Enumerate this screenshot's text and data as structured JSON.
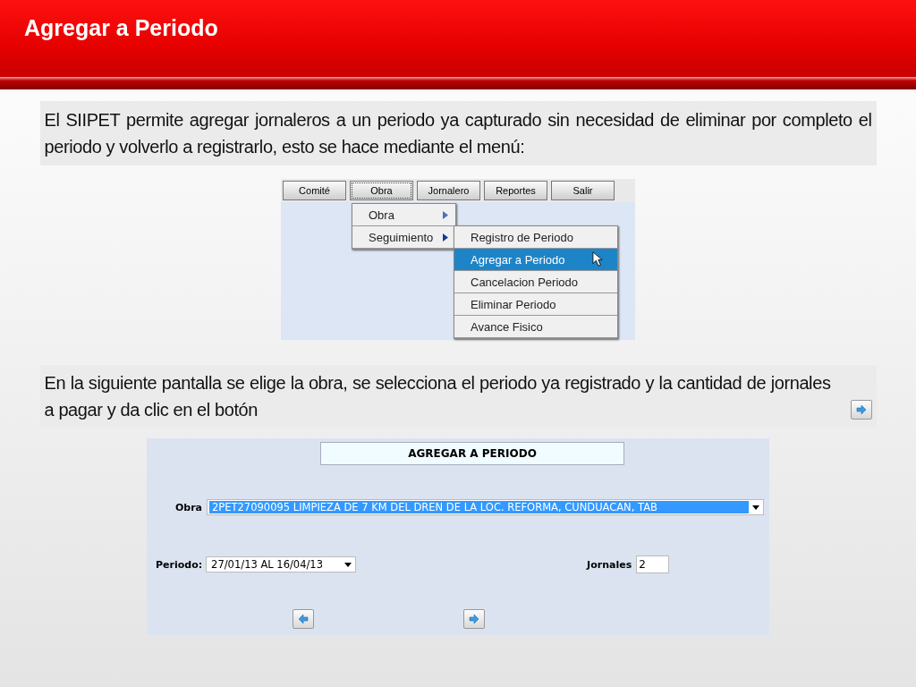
{
  "title": "Agregar a Periodo",
  "intro": "El SIIPET permite agregar jornaleros a un periodo ya capturado sin necesidad de eliminar por completo el periodo y volverlo a registrarlo, esto se hace mediante el menú:",
  "menu_screenshot": {
    "menu_bar": [
      {
        "label": "Comité",
        "selected": false
      },
      {
        "label": "Obra",
        "selected": true
      },
      {
        "label": "Jornalero",
        "selected": false
      },
      {
        "label": "Reportes",
        "selected": false
      },
      {
        "label": "Salir",
        "selected": false
      }
    ],
    "submenu": [
      {
        "label": "Obra",
        "expanded": false
      },
      {
        "label": "Seguimiento",
        "expanded": true
      }
    ],
    "submenu_items": [
      {
        "label": "Registro de Periodo",
        "selected": false
      },
      {
        "label": "Agregar a Periodo",
        "selected": true
      },
      {
        "label": "Cancelacion Periodo",
        "selected": false
      },
      {
        "label": "Eliminar Periodo",
        "selected": false
      },
      {
        "label": "Avance Fisico",
        "selected": false
      }
    ]
  },
  "instruction": "En la siguiente pantalla se elige la obra, se selecciona el periodo ya registrado y la cantidad de jornales a pagar y da clic en el botón",
  "form": {
    "title": "AGREGAR A PERIODO",
    "obra_label": "Obra",
    "obra_value": "2PET27090095 LIMPIEZA DE 7 KM DEL DREN DE LA LOC. REFORMA, CUNDUACAN, TAB",
    "obra_selected": true,
    "periodo_label": "Periodo:",
    "periodo_value": "27/01/13 AL 16/04/13",
    "jornales_label": "Jornales",
    "jornales_value": "2"
  }
}
